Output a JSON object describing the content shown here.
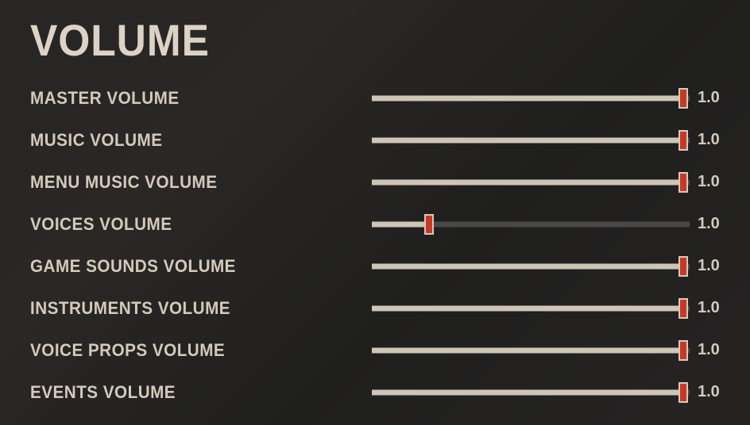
{
  "title": "VOLUME",
  "sliders": [
    {
      "id": "master",
      "label": "MASTER VOLUME",
      "value": 1.0,
      "display": "1.0",
      "handle_pos": 0.98
    },
    {
      "id": "music",
      "label": "MUSIC VOLUME",
      "value": 1.0,
      "display": "1.0",
      "handle_pos": 0.98
    },
    {
      "id": "menu-music",
      "label": "MENU MUSIC VOLUME",
      "value": 1.0,
      "display": "1.0",
      "handle_pos": 0.98
    },
    {
      "id": "voices",
      "label": "VOICES VOLUME",
      "value": 1.0,
      "display": "1.0",
      "handle_pos": 0.18
    },
    {
      "id": "game-sounds",
      "label": "GAME SOUNDS VOLUME",
      "value": 1.0,
      "display": "1.0",
      "handle_pos": 0.98
    },
    {
      "id": "instruments",
      "label": "INSTRUMENTS VOLUME",
      "value": 1.0,
      "display": "1.0",
      "handle_pos": 0.98
    },
    {
      "id": "voice-props",
      "label": "VOICE PROPS VOLUME",
      "value": 1.0,
      "display": "1.0",
      "handle_pos": 0.98
    },
    {
      "id": "events",
      "label": "EVENTS VOLUME",
      "value": 1.0,
      "display": "1.0",
      "handle_pos": 0.98
    }
  ],
  "colors": {
    "accent": "#c73924",
    "track_bg": "#4a4846",
    "track_fill": "#cec5b7",
    "text": "#d3cabc"
  }
}
